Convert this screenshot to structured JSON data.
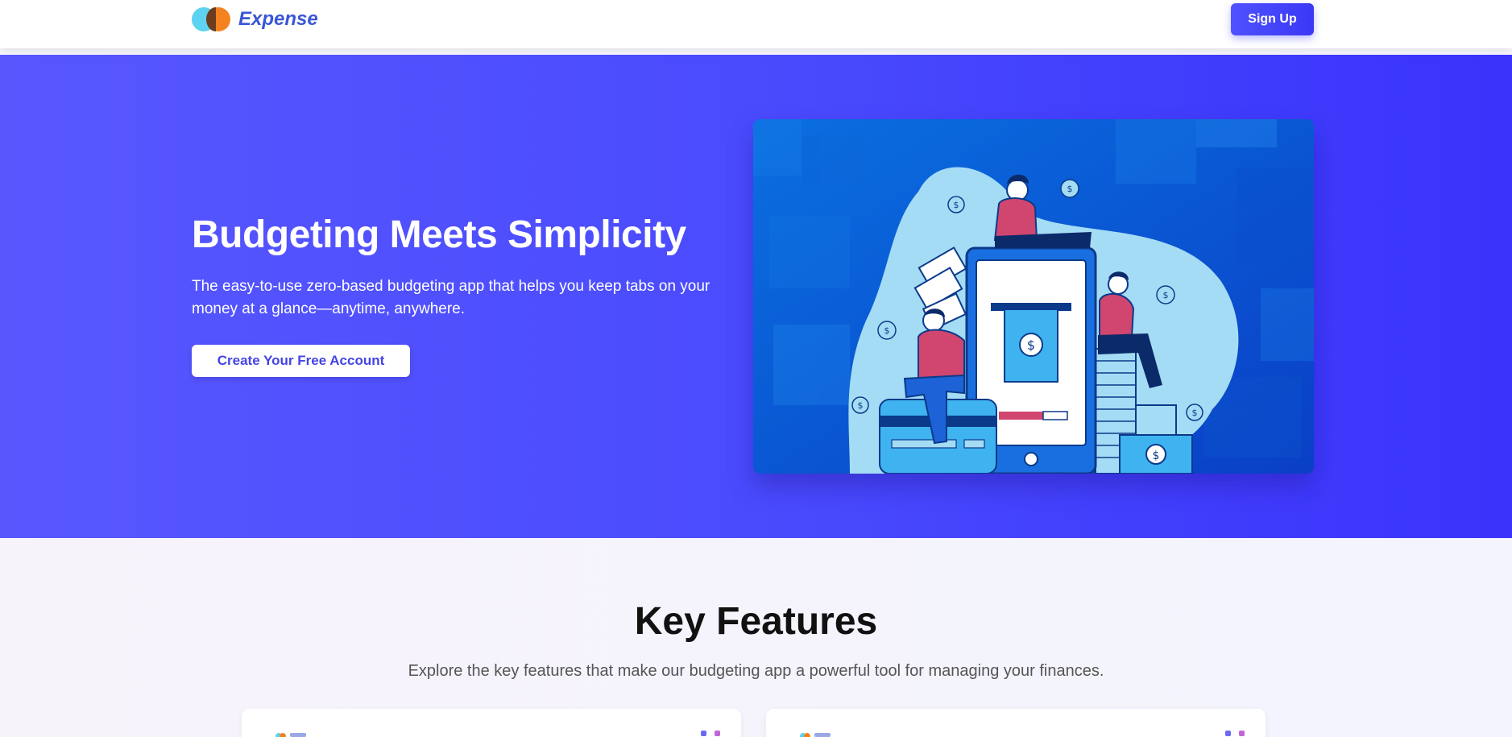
{
  "header": {
    "brand": "Expense",
    "signup_label": "Sign Up"
  },
  "hero": {
    "title": "Budgeting Meets Simplicity",
    "subtitle": "The easy-to-use zero-based budgeting app that helps you keep tabs on your money at a glance—anytime, anywhere.",
    "cta_label": "Create Your Free Account",
    "illustration_icon": "budgeting-illustration"
  },
  "features": {
    "title": "Key Features",
    "subtitle": "Explore the key features that make our budgeting app a powerful tool for managing your finances."
  },
  "colors": {
    "brand_blue": "#3b56d6",
    "hero_start": "#5857fe",
    "hero_end": "#3a33fb",
    "logo_cyan": "#5dd3f1",
    "logo_orange": "#f58220"
  }
}
